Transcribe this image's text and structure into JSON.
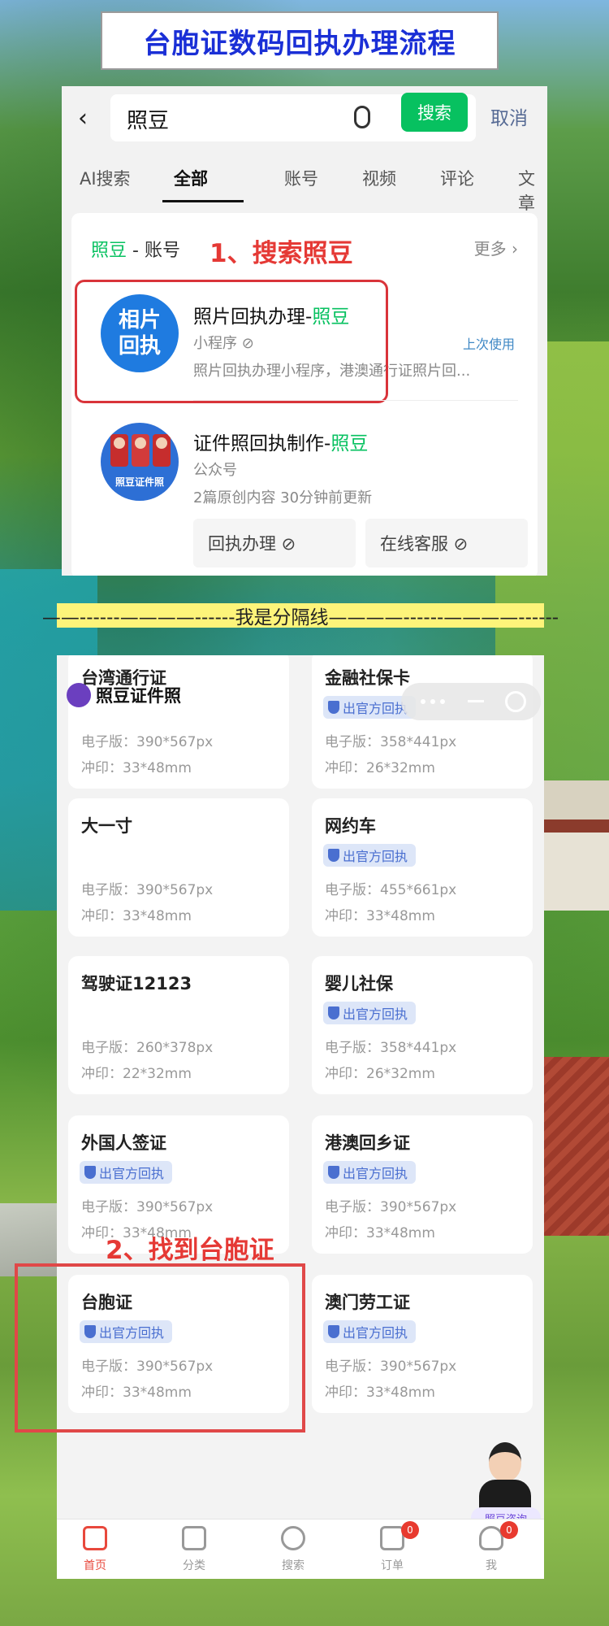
{
  "banner": {
    "title": "台胞证数码回执办理流程"
  },
  "search": {
    "back": "‹",
    "query": "照豆",
    "button": "搜索",
    "cancel": "取消",
    "tabs": [
      "AI搜索",
      "全部",
      "账号",
      "视频",
      "评论",
      "文章"
    ],
    "section_keyword": "照豆",
    "section_rest": " - 账号",
    "more": "更多 ›",
    "step1": "1、搜索照豆",
    "result1": {
      "logo": "相片\n回执",
      "title_prefix": "照片回执办理-",
      "title_kw": "照豆",
      "type": "小程序 ⊘",
      "desc": "照片回执办理小程序，港澳通行证照片回...",
      "recent": "上次使用"
    },
    "result2": {
      "logo_text": "照豆证件照",
      "title_prefix": "证件照回执制作-",
      "title_kw": "照豆",
      "type": "公众号",
      "desc": "2篇原创内容  30分钟前更新",
      "btn1": "回执办理 ⊘",
      "btn2": "在线客服 ⊘"
    }
  },
  "separator": "——------————------我是分隔线————------————------",
  "miniapp": {
    "name": "照豆证件照",
    "step2": "2、找到台胞证",
    "products": [
      {
        "name": "台湾通行证",
        "badge": "",
        "e": "电子版：390*567px",
        "p": "冲印：33*48mm"
      },
      {
        "name": "金融社保卡",
        "badge": "出官方回执",
        "e": "电子版：358*441px",
        "p": "冲印：26*32mm"
      },
      {
        "name": "大一寸",
        "badge": "",
        "e": "电子版：390*567px",
        "p": "冲印：33*48mm"
      },
      {
        "name": "网约车",
        "badge": "出官方回执",
        "e": "电子版：455*661px",
        "p": "冲印：33*48mm"
      },
      {
        "name": "驾驶证12123",
        "badge": "",
        "e": "电子版：260*378px",
        "p": "冲印：22*32mm"
      },
      {
        "name": "婴儿社保",
        "badge": "出官方回执",
        "e": "电子版：358*441px",
        "p": "冲印：26*32mm"
      },
      {
        "name": "外国人签证",
        "badge": "出官方回执",
        "e": "电子版：390*567px",
        "p": "冲印：33*48mm"
      },
      {
        "name": "港澳回乡证",
        "badge": "出官方回执",
        "e": "电子版：390*567px",
        "p": "冲印：33*48mm"
      },
      {
        "name": "台胞证",
        "badge": "出官方回执",
        "e": "电子版：390*567px",
        "p": "冲印：33*48mm"
      },
      {
        "name": "澳门劳工证",
        "badge": "出官方回执",
        "e": "电子版：390*567px",
        "p": "冲印：33*48mm"
      }
    ],
    "assistant": "照豆咨询",
    "nav": [
      {
        "label": "首页",
        "badge": ""
      },
      {
        "label": "分类",
        "badge": ""
      },
      {
        "label": "搜索",
        "badge": ""
      },
      {
        "label": "订单",
        "badge": "0"
      },
      {
        "label": "我",
        "badge": "0"
      }
    ]
  }
}
